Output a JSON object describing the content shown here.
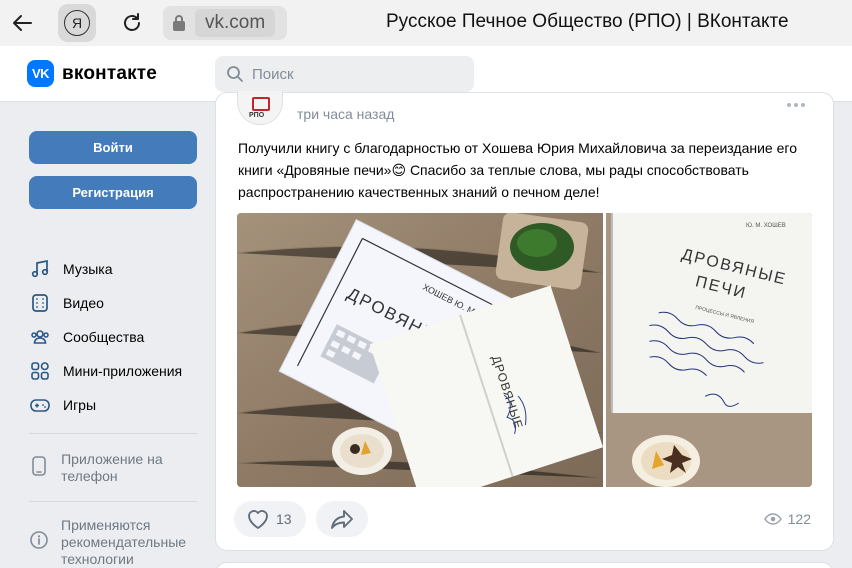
{
  "browser": {
    "url": "vk.com",
    "page_title": "Русское Печное Общество (РПО) | ВКонтакте",
    "yandex_letter": "Я"
  },
  "header": {
    "logo_mark": "VK",
    "logo_text": "вконтакте",
    "search_placeholder": "Поиск"
  },
  "auth": {
    "login": "Войти",
    "register": "Регистрация"
  },
  "menu": [
    {
      "label": "Музыка",
      "icon": "music-icon"
    },
    {
      "label": "Видео",
      "icon": "video-icon"
    },
    {
      "label": "Сообщества",
      "icon": "communities-icon"
    },
    {
      "label": "Мини-приложения",
      "icon": "mini-apps-icon"
    },
    {
      "label": "Игры",
      "icon": "games-icon"
    }
  ],
  "side_notes": {
    "app_phone": "Приложение на телефон",
    "recommend": "Применяются рекомендательные технологии"
  },
  "post": {
    "avatar_text": "РПО",
    "time": "три часа назад",
    "text": "Получили книгу с благодарностью от Хошева Юрия Михайловича за переиздание его книги «Дровяные печи»😊 Спасибо за теплые слова, мы рады способствовать распространению качественных знаний о печном деле!",
    "likes": "13",
    "views": "122",
    "book_title": "ДРОВЯНЫЕ ПЕЧИ",
    "book_author": "ХОШЕВ Ю. М.",
    "book_author_b": "Ю. М. ХОШЕВ",
    "book_subtitle": "ПРОЦЕССЫ И ЯВЛЕНИЯ"
  },
  "colors": {
    "accent": "#447bba",
    "vk_blue": "#0077ff",
    "page_bg": "#ebedf0"
  }
}
